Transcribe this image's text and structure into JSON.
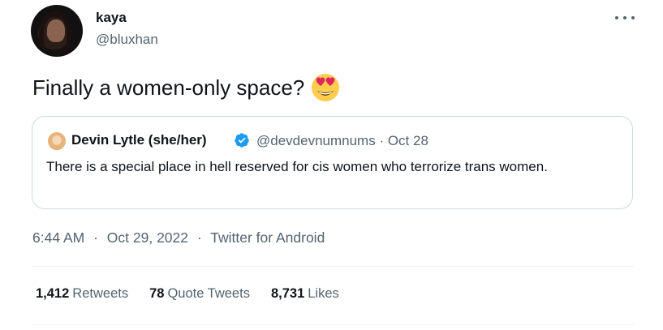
{
  "author": {
    "name": "kaya",
    "handle": "@bluxhan",
    "avatar_icon": "profile-photo"
  },
  "tweet": {
    "text": "Finally a women-only space?",
    "emoji": "smiling-face-with-heart-eyes"
  },
  "quoted": {
    "name": "Devin Lytle (she/her)",
    "verified": true,
    "handle_date": "@devdevnumnums · Oct 28",
    "text": "There is a special place in hell reserved for cis women who terrorize trans women."
  },
  "meta": {
    "time": "6:44 AM",
    "sep1": "·",
    "date": "Oct 29, 2022",
    "sep2": "·",
    "source": "Twitter for Android"
  },
  "stats": {
    "retweets_count": "1,412",
    "retweets_label": "Retweets",
    "quotes_count": "78",
    "quotes_label": "Quote Tweets",
    "likes_count": "8,731",
    "likes_label": "Likes"
  },
  "colors": {
    "verified": "#1d9bf0",
    "secondary_text": "#536471",
    "border": "#cfd9de"
  }
}
